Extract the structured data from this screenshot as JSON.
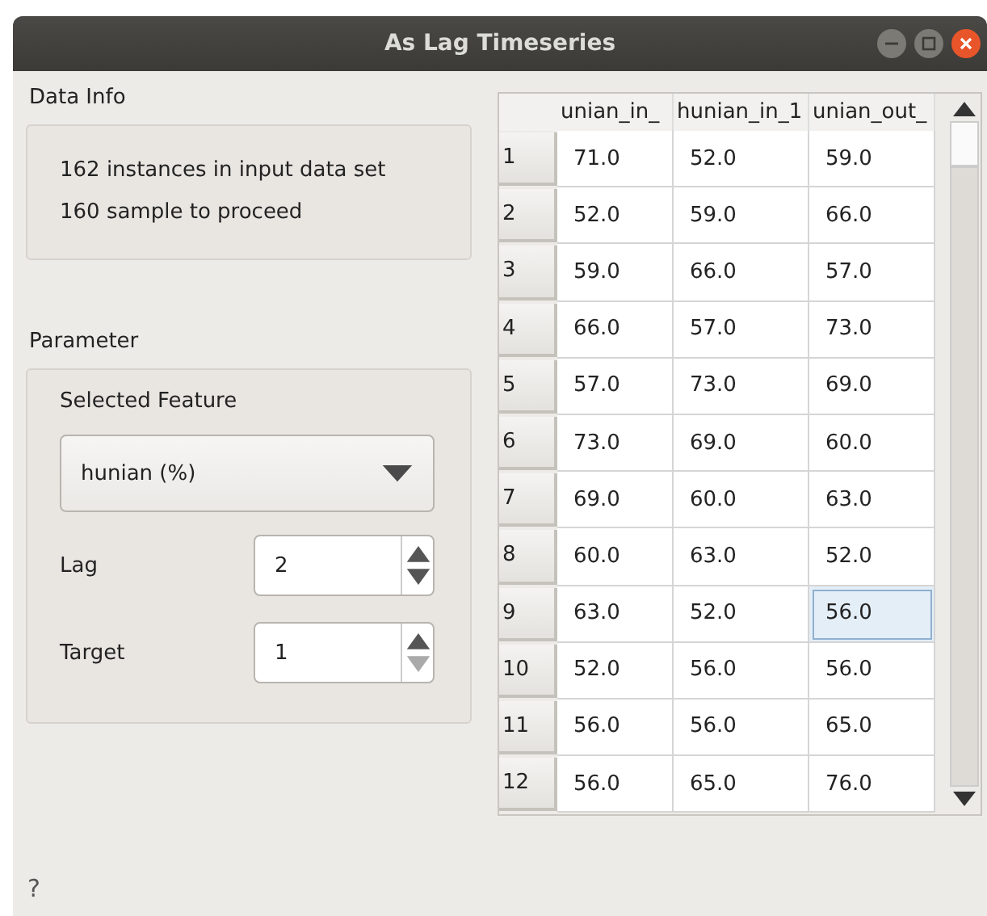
{
  "window": {
    "title": "As Lag Timeseries"
  },
  "help": "?",
  "data_info": {
    "title": "Data Info",
    "lines": [
      "162 instances in input data set",
      "160 sample to proceed"
    ]
  },
  "parameter": {
    "title": "Parameter",
    "feature_label": "Selected Feature",
    "feature_value": "hunian (%)",
    "spinners": [
      {
        "label": "Lag",
        "value": "2",
        "down_disabled": false
      },
      {
        "label": "Target",
        "value": "1",
        "down_disabled": true
      }
    ]
  },
  "table": {
    "columns": [
      "unian_in_",
      "hunian_in_1",
      "unian_out_"
    ],
    "rows": [
      {
        "header": "1",
        "cells": [
          {
            "text": "71.0",
            "selected": false
          },
          {
            "text": "52.0",
            "selected": false
          },
          {
            "text": "59.0",
            "selected": false
          }
        ]
      },
      {
        "header": "2",
        "cells": [
          {
            "text": "52.0",
            "selected": false
          },
          {
            "text": "59.0",
            "selected": false
          },
          {
            "text": "66.0",
            "selected": false
          }
        ]
      },
      {
        "header": "3",
        "cells": [
          {
            "text": "59.0",
            "selected": false
          },
          {
            "text": "66.0",
            "selected": false
          },
          {
            "text": "57.0",
            "selected": false
          }
        ]
      },
      {
        "header": "4",
        "cells": [
          {
            "text": "66.0",
            "selected": false
          },
          {
            "text": "57.0",
            "selected": false
          },
          {
            "text": "73.0",
            "selected": false
          }
        ]
      },
      {
        "header": "5",
        "cells": [
          {
            "text": "57.0",
            "selected": false
          },
          {
            "text": "73.0",
            "selected": false
          },
          {
            "text": "69.0",
            "selected": false
          }
        ]
      },
      {
        "header": "6",
        "cells": [
          {
            "text": "73.0",
            "selected": false
          },
          {
            "text": "69.0",
            "selected": false
          },
          {
            "text": "60.0",
            "selected": false
          }
        ]
      },
      {
        "header": "7",
        "cells": [
          {
            "text": "69.0",
            "selected": false
          },
          {
            "text": "60.0",
            "selected": false
          },
          {
            "text": "63.0",
            "selected": false
          }
        ]
      },
      {
        "header": "8",
        "cells": [
          {
            "text": "60.0",
            "selected": false
          },
          {
            "text": "63.0",
            "selected": false
          },
          {
            "text": "52.0",
            "selected": false
          }
        ]
      },
      {
        "header": "9",
        "cells": [
          {
            "text": "63.0",
            "selected": false
          },
          {
            "text": "52.0",
            "selected": false
          },
          {
            "text": "56.0",
            "selected": true
          }
        ]
      },
      {
        "header": "10",
        "cells": [
          {
            "text": "52.0",
            "selected": false
          },
          {
            "text": "56.0",
            "selected": false
          },
          {
            "text": "56.0",
            "selected": false
          }
        ]
      },
      {
        "header": "11",
        "cells": [
          {
            "text": "56.0",
            "selected": false
          },
          {
            "text": "56.0",
            "selected": false
          },
          {
            "text": "65.0",
            "selected": false
          }
        ]
      },
      {
        "header": "12",
        "cells": [
          {
            "text": "56.0",
            "selected": false
          },
          {
            "text": "65.0",
            "selected": false
          },
          {
            "text": "76.0",
            "selected": false
          }
        ]
      }
    ]
  }
}
